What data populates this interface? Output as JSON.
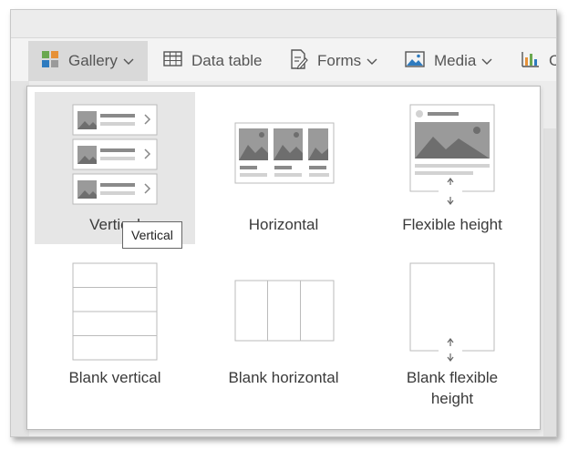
{
  "toolbar": {
    "items": [
      {
        "label": "Gallery",
        "icon": "gallery-icon",
        "has_dropdown": true,
        "active": true
      },
      {
        "label": "Data table",
        "icon": "table-icon",
        "has_dropdown": false
      },
      {
        "label": "Forms",
        "icon": "forms-icon",
        "has_dropdown": true
      },
      {
        "label": "Media",
        "icon": "image-icon",
        "has_dropdown": true
      },
      {
        "label": "C",
        "icon": "chart-icon",
        "has_dropdown": false
      }
    ]
  },
  "gallery_menu": {
    "options": [
      {
        "label": "Vertical",
        "icon": "vertical-gallery-icon",
        "selected": true
      },
      {
        "label": "Horizontal",
        "icon": "horizontal-gallery-icon"
      },
      {
        "label": "Flexible height",
        "icon": "flexible-height-gallery-icon"
      },
      {
        "label": "Blank vertical",
        "icon": "blank-vertical-gallery-icon"
      },
      {
        "label": "Blank horizontal",
        "icon": "blank-horizontal-gallery-icon"
      },
      {
        "label": "Blank flexible\nheight",
        "icon": "blank-flexible-height-gallery-icon"
      }
    ],
    "tooltip": "Vertical"
  },
  "colors": {
    "accent_green": "#6aa84f",
    "accent_orange": "#e69138",
    "accent_blue": "#2e7bbf",
    "icon_gray": "#8a8a8a",
    "selected_bg": "#e6e6e6"
  }
}
